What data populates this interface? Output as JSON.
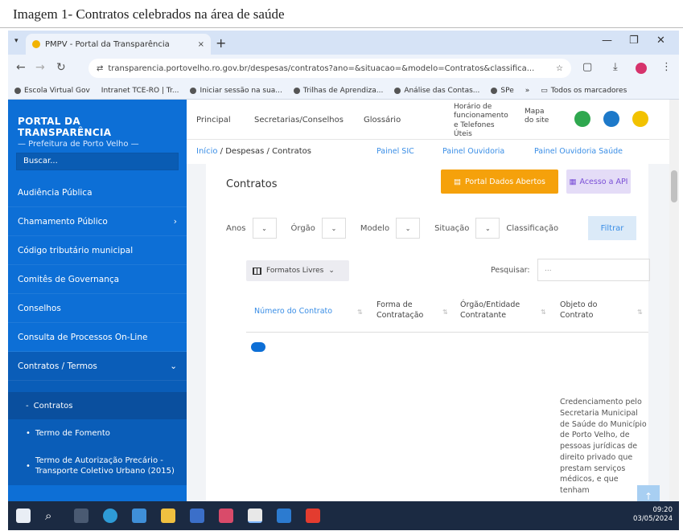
{
  "caption": "Imagem 1- Contratos celebrados na área de saúde",
  "browser": {
    "tab_title": "PMPV - Portal da Transparência",
    "tab_close": "×",
    "new_tab": "+",
    "url": "transparencia.portovelho.ro.gov.br/despesas/contratos?ano=&situacao=&modelo=Contratos&classifica...",
    "bookmarks": [
      "Escola Virtual Gov",
      "Intranet TCE-RO | Tr...",
      "Iniciar sessão na sua...",
      "Trilhas de Aprendiza...",
      "Análise das Contas...",
      "SPe",
      "Todos os marcadores"
    ]
  },
  "sidebar": {
    "brand_title": "PORTAL DA TRANSPARÊNCIA",
    "brand_sub": "— Prefeitura de Porto Velho —",
    "search_placeholder": "Buscar...",
    "items": [
      {
        "label": "Audiência Pública"
      },
      {
        "label": "Chamamento Público",
        "chevron": "›"
      },
      {
        "label": "Código tributário municipal"
      },
      {
        "label": "Comitês de Governança"
      },
      {
        "label": "Conselhos"
      },
      {
        "label": "Consulta de Processos On-Line"
      },
      {
        "label": "Contratos / Termos",
        "chevron": "⌄"
      }
    ],
    "subitems": [
      {
        "label": "Contratos",
        "bullet": "-"
      },
      {
        "label": "Termo de Fomento",
        "bullet": "•"
      },
      {
        "label": "Termo de Autorização Precário - Transporte Coletivo Urbano (2015)",
        "bullet": "•"
      }
    ]
  },
  "header": {
    "links": [
      "Principal",
      "Secretarias/Conselhos",
      "Glossário",
      "Horário de funcionamento e Telefones Úteis",
      "Mapa do site"
    ]
  },
  "breadcrumb": {
    "home": "Início",
    "parts": [
      "Despesas",
      "Contratos"
    ],
    "quick_links": [
      "Painel SIC",
      "Painel Ouvidoria",
      "Painel Ouvidoria Saúde"
    ]
  },
  "card": {
    "title": "Contratos",
    "btn_open_data": "Portal Dados Abertos",
    "btn_api": "Acesso a API",
    "filters": [
      "Anos",
      "Órgão",
      "Modelo",
      "Situação",
      "Classificação"
    ],
    "btn_filter": "Filtrar",
    "formats": "Formatos Livres",
    "search_label": "Pesquisar:",
    "search_placeholder": "...",
    "columns": [
      "Número do Contrato",
      "Forma de Contratação",
      "Órgão/Entidade Contratante",
      "Objeto do Contrato"
    ],
    "object_text": "Credenciamento pelo Secretaria Municipal de Saúde do Município de Porto Velho, de pessoas jurídicas de direito privado que prestam serviços médicos, e que tenham"
  },
  "taskbar": {
    "time": "09:20",
    "date": "03/05/2024"
  }
}
